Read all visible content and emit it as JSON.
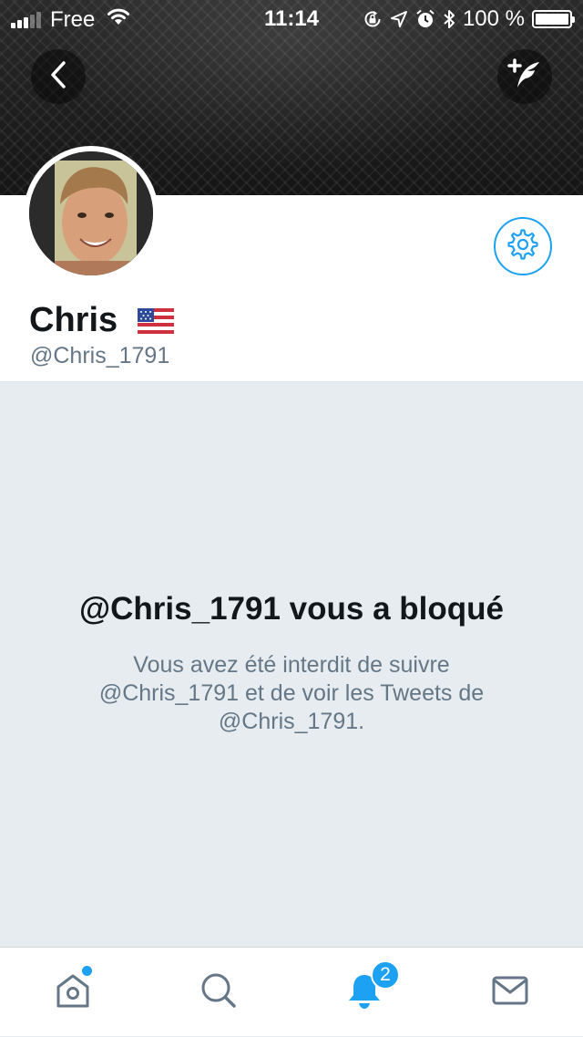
{
  "status_bar": {
    "carrier": "Free",
    "time": "11:14",
    "battery": "100 %",
    "battery_level": 1.0
  },
  "header": {
    "back_icon": "chevron-left-icon",
    "compose_icon": "compose-tweet-icon"
  },
  "profile": {
    "display_name": "Chris",
    "flag_icon": "us-flag-icon",
    "handle": "@Chris_1791",
    "settings_icon": "gear-icon"
  },
  "blocked": {
    "title": "@Chris_1791 vous a bloqué",
    "description": "Vous avez été interdit de suivre @Chris_1791 et de voir les Tweets de @Chris_1791."
  },
  "tab_bar": {
    "tabs": [
      {
        "icon": "home-icon",
        "has_dot": true
      },
      {
        "icon": "search-icon"
      },
      {
        "icon": "bell-icon",
        "badge": "2",
        "active": true
      },
      {
        "icon": "mail-icon"
      }
    ]
  },
  "colors": {
    "accent": "#1da1f2",
    "text_primary": "#14171a",
    "text_secondary": "#657786",
    "background": "#e6ecf0"
  }
}
